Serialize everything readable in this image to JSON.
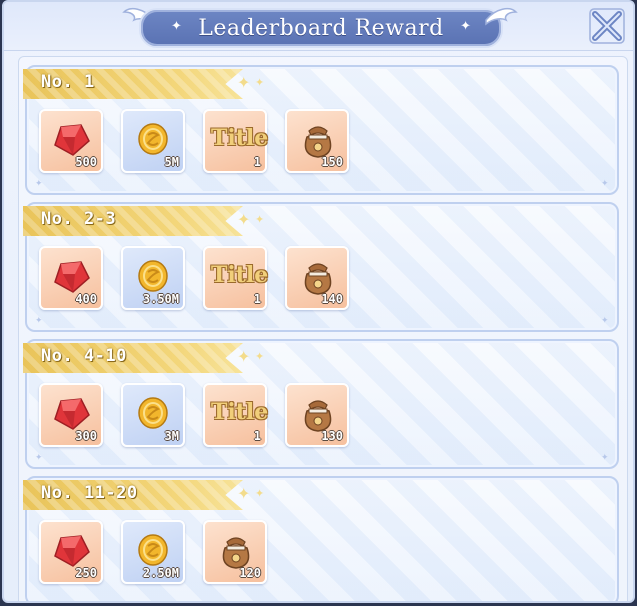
{
  "header": {
    "title": "Leaderboard Reward"
  },
  "icons": {
    "gem": "red-gem-icon",
    "coin": "gold-coin-icon",
    "title": "title-badge-icon",
    "bag": "treasure-bag-icon",
    "close": "close-icon"
  },
  "colors": {
    "ribbon": "#f3d67a",
    "plaque": "#6d86c4",
    "panel": "#eef3fd"
  },
  "tiers": [
    {
      "rank": "No. 1",
      "rewards": [
        {
          "type": "gem",
          "qty": "500"
        },
        {
          "type": "coin",
          "qty": "5M"
        },
        {
          "type": "title",
          "label": "Title",
          "qty": "1"
        },
        {
          "type": "bag",
          "qty": "150"
        }
      ]
    },
    {
      "rank": "No. 2-3",
      "rewards": [
        {
          "type": "gem",
          "qty": "400"
        },
        {
          "type": "coin",
          "qty": "3.50M"
        },
        {
          "type": "title",
          "label": "Title",
          "qty": "1"
        },
        {
          "type": "bag",
          "qty": "140"
        }
      ]
    },
    {
      "rank": "No. 4-10",
      "rewards": [
        {
          "type": "gem",
          "qty": "300"
        },
        {
          "type": "coin",
          "qty": "3M"
        },
        {
          "type": "title",
          "label": "Title",
          "qty": "1"
        },
        {
          "type": "bag",
          "qty": "130"
        }
      ]
    },
    {
      "rank": "No. 11-20",
      "rewards": [
        {
          "type": "gem",
          "qty": "250"
        },
        {
          "type": "coin",
          "qty": "2.50M"
        },
        {
          "type": "bag",
          "qty": "120"
        }
      ]
    }
  ]
}
